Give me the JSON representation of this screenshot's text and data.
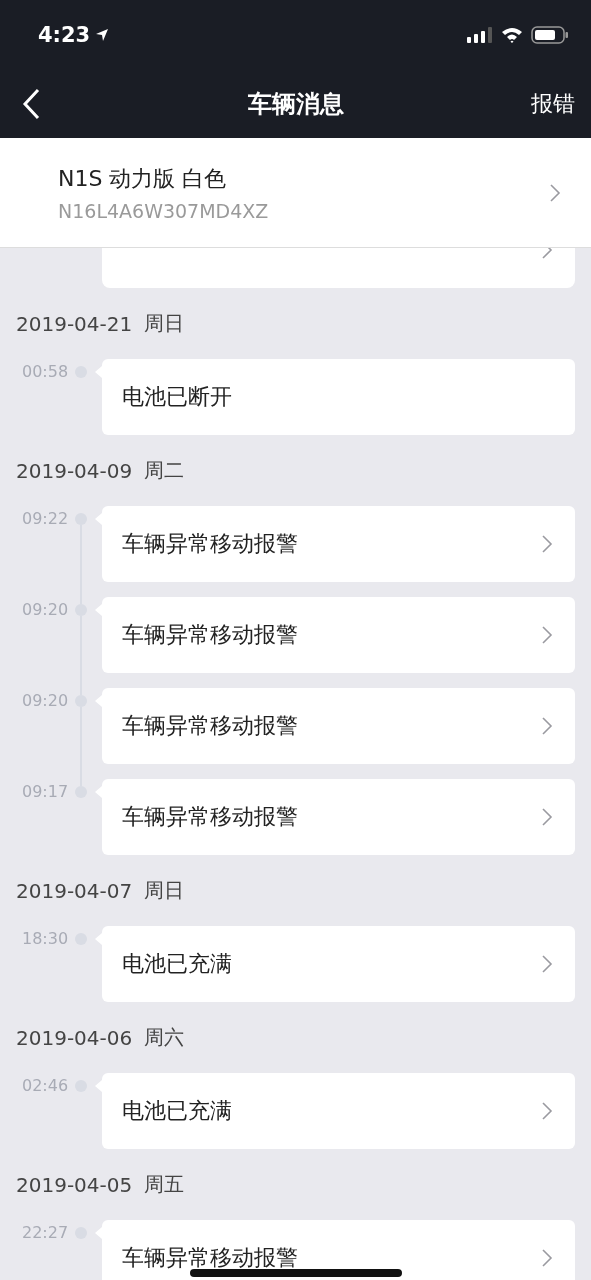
{
  "status_bar": {
    "time": "4:23"
  },
  "nav": {
    "title": "车辆消息",
    "action": "报错"
  },
  "vehicle": {
    "name": "N1S 动力版 白色",
    "vin": "N16L4A6W307MD4XZ"
  },
  "partial_card": {
    "has_arrow": true
  },
  "groups": [
    {
      "date": "2019-04-21",
      "weekday": "周日",
      "messages": [
        {
          "time": "00:58",
          "text": "电池已断开",
          "has_arrow": false
        }
      ]
    },
    {
      "date": "2019-04-09",
      "weekday": "周二",
      "messages": [
        {
          "time": "09:22",
          "text": "车辆异常移动报警",
          "has_arrow": true
        },
        {
          "time": "09:20",
          "text": "车辆异常移动报警",
          "has_arrow": true
        },
        {
          "time": "09:20",
          "text": "车辆异常移动报警",
          "has_arrow": true
        },
        {
          "time": "09:17",
          "text": "车辆异常移动报警",
          "has_arrow": true
        }
      ]
    },
    {
      "date": "2019-04-07",
      "weekday": "周日",
      "messages": [
        {
          "time": "18:30",
          "text": "电池已充满",
          "has_arrow": true
        }
      ]
    },
    {
      "date": "2019-04-06",
      "weekday": "周六",
      "messages": [
        {
          "time": "02:46",
          "text": "电池已充满",
          "has_arrow": true
        }
      ]
    },
    {
      "date": "2019-04-05",
      "weekday": "周五",
      "messages": [
        {
          "time": "22:27",
          "text": "车辆异常移动报警",
          "has_arrow": true
        }
      ]
    }
  ]
}
